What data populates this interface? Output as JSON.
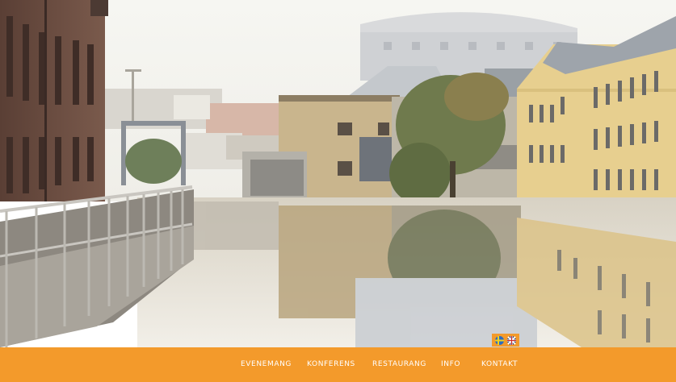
{
  "colors": {
    "accent": "#f39a2b",
    "nav_text": "#ffffff",
    "sky": "#f4f4ef",
    "water": "#e8e3d8"
  },
  "hero": {
    "icon": "canal-city-photo"
  },
  "language": {
    "items": [
      {
        "icon": "swedish-flag-icon"
      },
      {
        "icon": "british-flag-icon"
      }
    ]
  },
  "nav": {
    "items": [
      {
        "label": "EVENEMANG"
      },
      {
        "label": "KONFERENS"
      },
      {
        "label": "RESTAURANG"
      },
      {
        "label": "INFO"
      },
      {
        "label": "KONTAKT"
      }
    ]
  }
}
